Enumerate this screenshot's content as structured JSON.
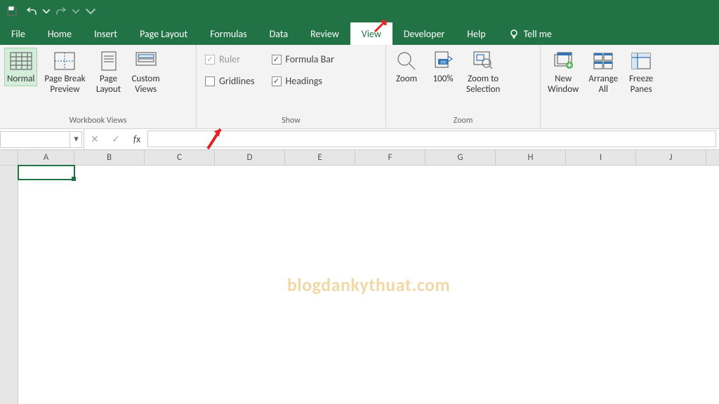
{
  "qat": {
    "save": "Save",
    "undo": "Undo",
    "redo": "Redo",
    "repeat": "Repeat"
  },
  "tabs": {
    "file": "File",
    "home": "Home",
    "insert": "Insert",
    "page_layout": "Page Layout",
    "formulas": "Formulas",
    "data": "Data",
    "review": "Review",
    "view": "View",
    "developer": "Developer",
    "help": "Help",
    "tellme": "Tell me"
  },
  "ribbon": {
    "workbook_views": {
      "label": "Workbook Views",
      "normal": "Normal",
      "page_break": "Page Break\nPreview",
      "page_layout": "Page\nLayout",
      "custom_views": "Custom\nViews"
    },
    "show": {
      "label": "Show",
      "ruler": "Ruler",
      "gridlines": "Gridlines",
      "formula_bar": "Formula Bar",
      "headings": "Headings"
    },
    "zoom": {
      "label": "Zoom",
      "zoom": "Zoom",
      "hundred": "100%",
      "zoom_selection": "Zoom to\nSelection"
    },
    "window": {
      "new_window": "New\nWindow",
      "arrange_all": "Arrange\nAll",
      "freeze_panes": "Freeze\nPanes"
    }
  },
  "formula_bar": {
    "namebox": "",
    "fx": "fx"
  },
  "columns": [
    "A",
    "B",
    "C",
    "D",
    "E",
    "F",
    "G",
    "H",
    "I",
    "J"
  ],
  "selected_cell": {
    "col": "A",
    "row": 1
  },
  "watermark": "blogdankythuat.com"
}
